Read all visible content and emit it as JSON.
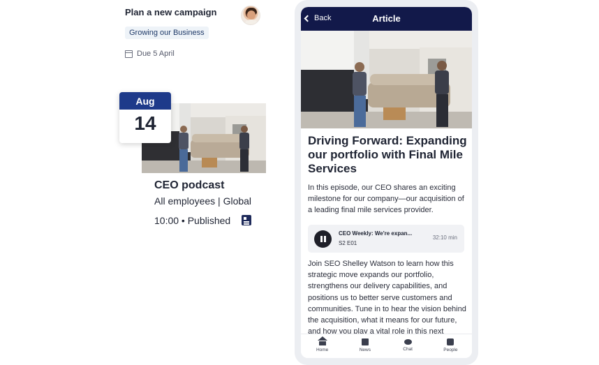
{
  "campaign": {
    "title": "Plan a new campaign",
    "tag": "Growing our Business",
    "due": "Due 5 April"
  },
  "event": {
    "month": "Aug",
    "day": "14",
    "title": "CEO podcast",
    "audience": "All employees | Global",
    "meta": "10:00 • Published"
  },
  "article": {
    "back_label": "Back",
    "screen_title": "Article",
    "headline": "Driving Forward: Expanding our portfolio with Final Mile Services",
    "intro": "In this episode, our CEO shares an exciting milestone for our company—our acquisition of a leading final mile services provider.",
    "player": {
      "title": "CEO Weekly: We're expan...",
      "code": "S2 E01",
      "duration": "32:10 min"
    },
    "body": "Join SEO Shelley Watson to learn how this strategic move expands our portfolio, strengthens our delivery capabilities, and positions us to better serve customers and communities. Tune in to hear the vision behind the acquisition, what it means for our future, and how you play a vital role in this next"
  },
  "tabs": [
    {
      "label": "Home",
      "icon": "home-icon"
    },
    {
      "label": "News",
      "icon": "news-icon"
    },
    {
      "label": "Chat",
      "icon": "chat-icon"
    },
    {
      "label": "People",
      "icon": "people-icon"
    }
  ],
  "colors": {
    "navy": "#12194a",
    "badge_blue": "#1e3a8a",
    "tag_bg": "#eef3f8"
  }
}
